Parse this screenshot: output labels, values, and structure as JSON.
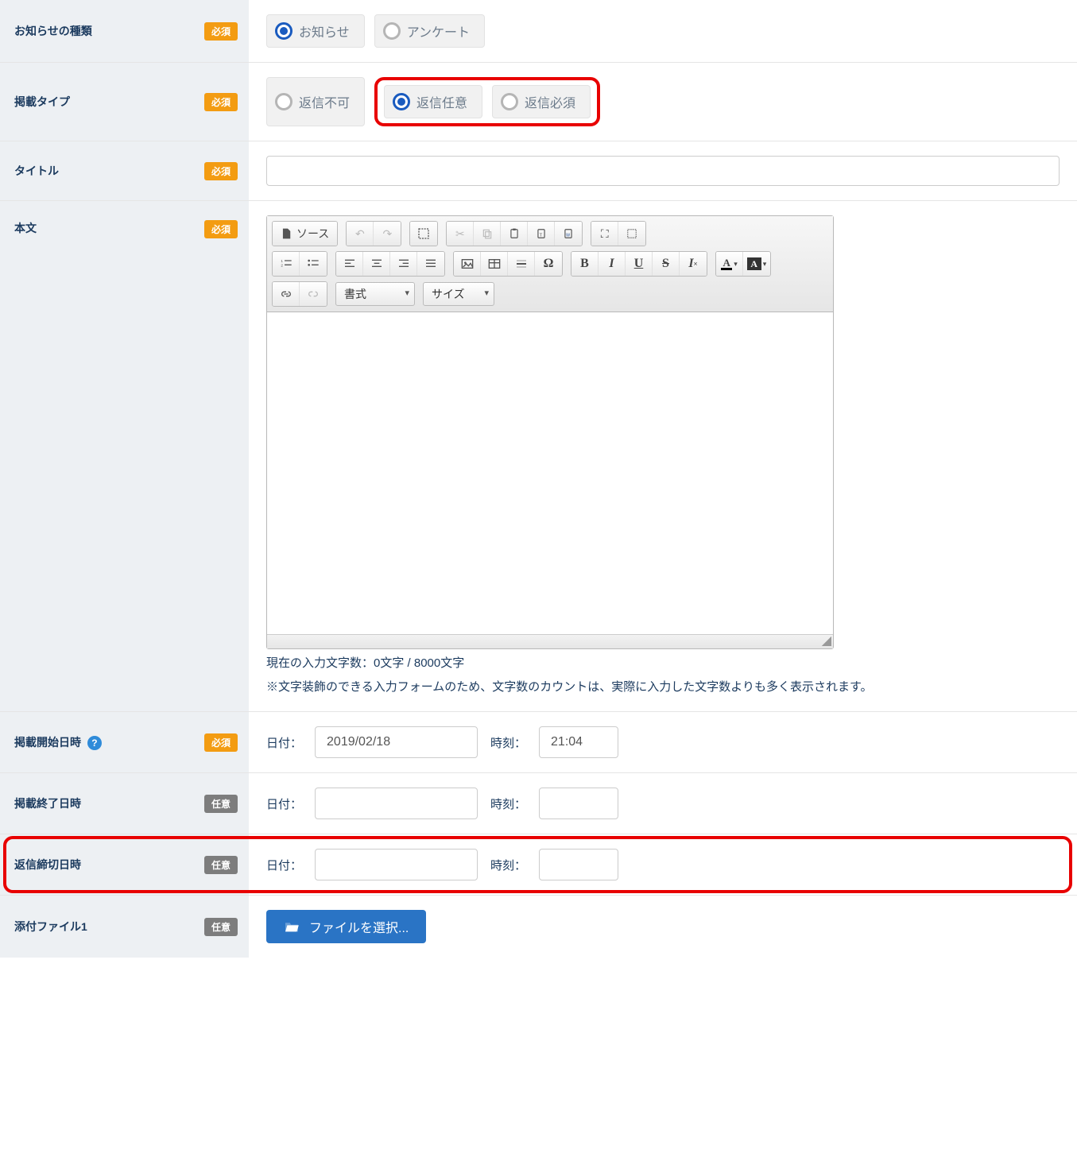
{
  "labels": {
    "type": "お知らせの種類",
    "postType": "掲載タイプ",
    "title": "タイトル",
    "body": "本文",
    "startDate": "掲載開始日時",
    "endDate": "掲載終了日時",
    "replyDeadline": "返信締切日時",
    "file1": "添付ファイル1"
  },
  "badges": {
    "required": "必須",
    "optional": "任意"
  },
  "typeOptions": {
    "notice": "お知らせ",
    "survey": "アンケート"
  },
  "postTypeOptions": {
    "noReply": "返信不可",
    "replyOptional": "返信任意",
    "replyRequired": "返信必須"
  },
  "editor": {
    "source": "ソース",
    "format": "書式",
    "size": "サイズ"
  },
  "charCount": "現在の入力文字数：0文字 / 8000文字",
  "charCountNote": "※文字装飾のできる入力フォームのため、文字数のカウントは、実際に入力した文字数よりも多く表示されます。",
  "dateLabel": "日付：",
  "timeLabel": "時刻：",
  "startDateValue": "2019/02/18",
  "startTimeValue": "21:04",
  "fileSelect": "ファイルを選択..."
}
